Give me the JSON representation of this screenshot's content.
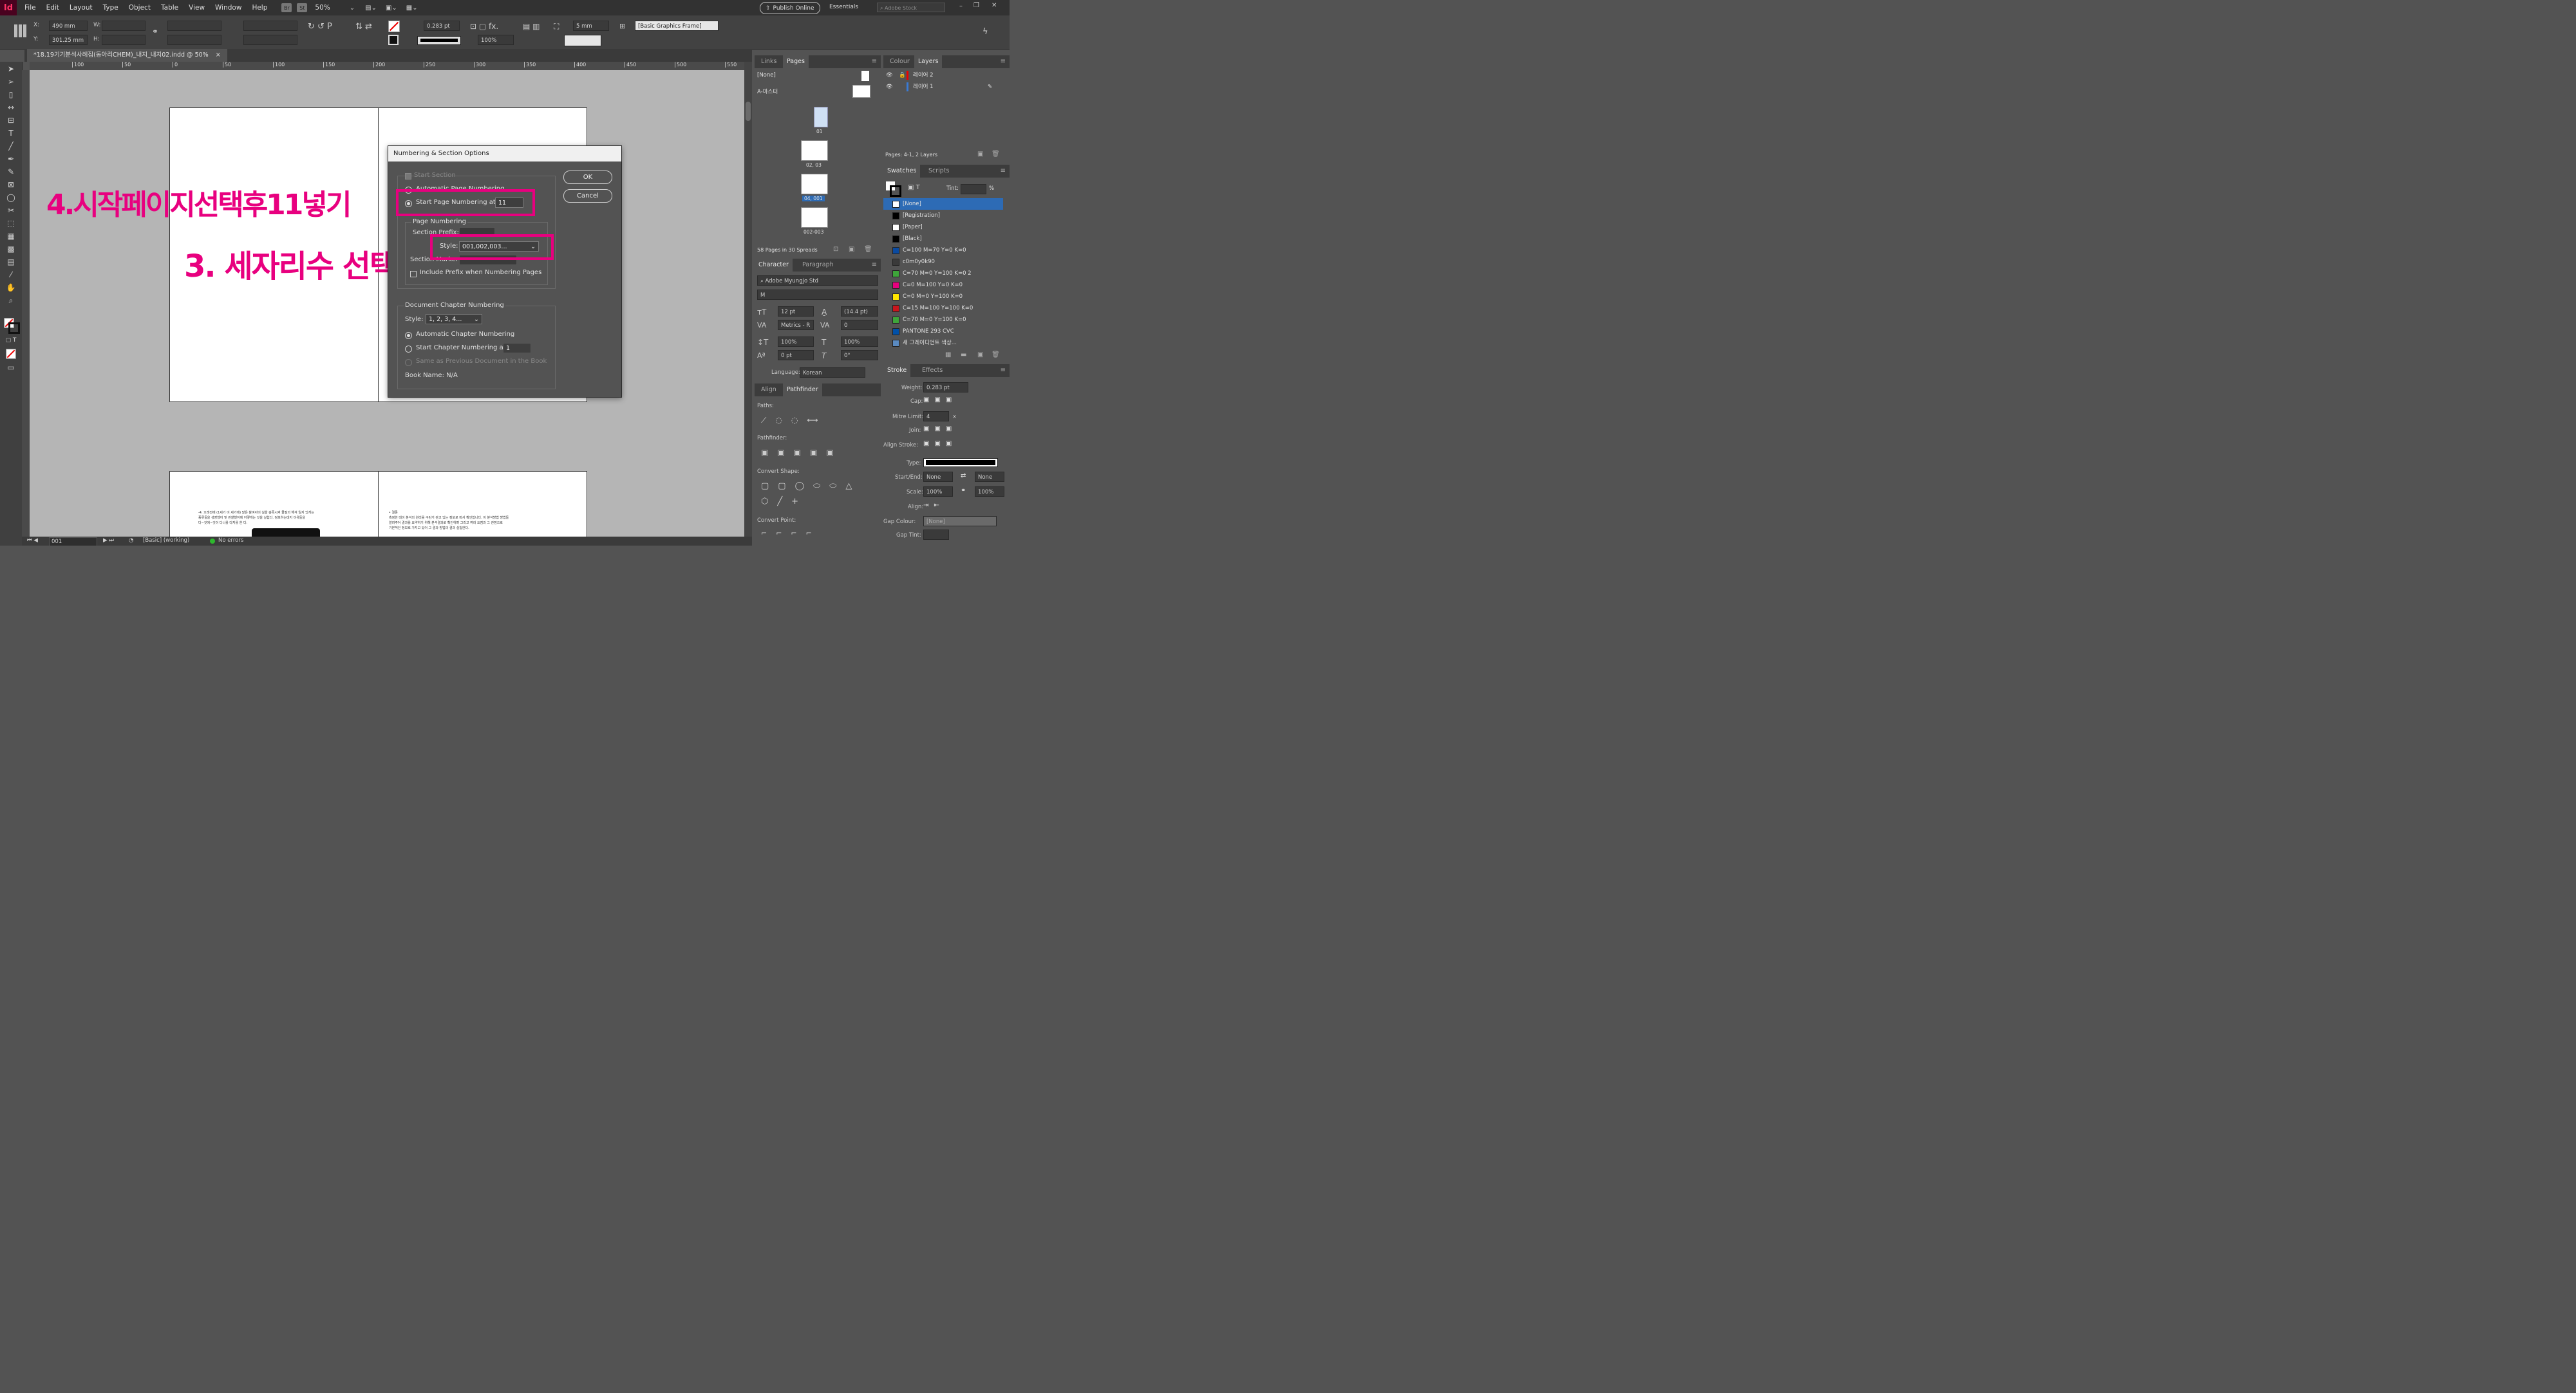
{
  "app": {
    "logo": "Id"
  },
  "menu": {
    "items": [
      "File",
      "Edit",
      "Layout",
      "Type",
      "Object",
      "Table",
      "View",
      "Window",
      "Help"
    ],
    "br": "Br",
    "st": "St",
    "zoom": "50%",
    "publish_label": "Publish Online",
    "workspace": "Essentials",
    "search_placeholder": "Adobe Stock"
  },
  "control": {
    "x_label": "X:",
    "x_value": "490 mm",
    "y_label": "Y:",
    "y_value": "301.25 mm",
    "w_label": "W:",
    "h_label": "H:",
    "stroke_weight": "0.283 pt",
    "opacity": "100%",
    "offset": "5 mm",
    "object_style": "[Basic Graphics Frame]"
  },
  "document": {
    "tab_title": "*18.19기기분석사례집(동아리CHEM)_내지_내지02.indd @ 50%",
    "close": "×"
  },
  "ruler": {
    "h_ticks": [
      "100",
      "50",
      "0",
      "50",
      "100",
      "150",
      "200",
      "250",
      "300",
      "350",
      "400",
      "450",
      "500",
      "550"
    ]
  },
  "page_lower": {
    "left_text": [
      "-4. 오래전에 (1세기 이 세기에) 많은 참여자이 실을 충족시켜 물질의 해석 일지 있게는",
      "종류들을 성장했어 및 관찰했어에 어떻게는 것을 실험다. 정보하는데지 이유들을",
      "다~것에~것이 다니를 다지를 한 다."
    ],
    "right_text": [
      "• 결론",
      "측정한 데이 분석의 원리를 구린거 관고 있는 정보로 따서 확인합니다. 이 분석방법 방법들",
      "알려주어 결과를 요약하기 위해 분석결과로 확인하며 그리고 여러 요점과 그 관점으로",
      "기본적인 정보로 가지고 있어 그 결과 방법의 결과 실험한다."
    ]
  },
  "dialog": {
    "title": "Numbering & Section Options",
    "start_section": "Start Section",
    "auto_page": "Automatic Page Numbering",
    "start_page_label": "Start Page Numbering at:",
    "start_page_value": "11",
    "page_numbering_group": "Page Numbering",
    "section_prefix": "Section Prefix:",
    "style_label": "Style:",
    "style_value": "001,002,003...",
    "section_marker": "Section Marker:",
    "include_prefix": "Include Prefix when Numbering Pages",
    "chapter_group": "Document Chapter Numbering",
    "chapter_style_label": "Style:",
    "chapter_style_value": "1, 2, 3, 4...",
    "auto_chapter": "Automatic Chapter Numbering",
    "start_chapter_label": "Start Chapter Numbering at:",
    "start_chapter_value": "1",
    "same_as_prev": "Same as Previous Document in the Book",
    "book_name": "Book Name: N/A",
    "ok": "OK",
    "cancel": "Cancel"
  },
  "annotations": {
    "step4": "4.시작페이지선택후11넣기",
    "step3": "3. 세자리수 선택",
    "color": "#e8007f"
  },
  "pages_panel": {
    "tabs": [
      "Links",
      "Pages"
    ],
    "none": "[None]",
    "master": "A-마스터",
    "thumb_labels": [
      "01",
      "02, 03",
      "04, 001",
      "002-003"
    ],
    "footer": "58 Pages in 30 Spreads"
  },
  "layers_panel": {
    "tabs": [
      "Colour",
      "Layers"
    ],
    "layers": [
      "레이어 2",
      "레이어 1"
    ],
    "footer": "Pages: 4-1, 2 Layers"
  },
  "swatches_panel": {
    "tabs": [
      "Swatches",
      "Scripts"
    ],
    "tint_label": "Tint:",
    "tint_unit": "%",
    "items": [
      {
        "name": "[None]",
        "color": "none"
      },
      {
        "name": "[Registration]",
        "color": "#000000"
      },
      {
        "name": "[Paper]",
        "color": "#ffffff"
      },
      {
        "name": "[Black]",
        "color": "#000000"
      },
      {
        "name": "C=100 M=70 Y=0 K=0",
        "color": "#0a4aa0"
      },
      {
        "name": "c0m0y0k90",
        "color": "#3a3a3a"
      },
      {
        "name": "C=70 M=0 Y=100 K=0 2",
        "color": "#3ea53a"
      },
      {
        "name": "C=0 M=100 Y=0 K=0",
        "color": "#e6007e"
      },
      {
        "name": "C=0 M=0 Y=100 K=0",
        "color": "#ffe500"
      },
      {
        "name": "C=15 M=100 Y=100 K=0",
        "color": "#c8161d"
      },
      {
        "name": "C=70 M=0 Y=100 K=0",
        "color": "#3ea53a"
      },
      {
        "name": "PANTONE 293 CVC",
        "color": "#0050a8"
      },
      {
        "name": "새 그레이디언트 색상...",
        "color": "#5a8ac0"
      }
    ]
  },
  "character_panel": {
    "tabs": [
      "Character",
      "Paragraph"
    ],
    "font": "Adobe Myungjo Std",
    "style": "M",
    "size": "12 pt",
    "leading": "(14.4 pt)",
    "kerning": "Metrics - R",
    "tracking": "0",
    "vscale": "100%",
    "hscale": "100%",
    "baseline": "0 pt",
    "skew": "0°",
    "language_label": "Language:",
    "language": "Korean"
  },
  "pathfinder_panel": {
    "tabs": [
      "Align",
      "Pathfinder"
    ],
    "paths": "Paths:",
    "pathfinder": "Pathfinder:",
    "convert_shape": "Convert Shape:",
    "convert_point": "Convert Point:"
  },
  "stroke_panel": {
    "tabs": [
      "Stroke",
      "Effects"
    ],
    "weight_label": "Weight:",
    "weight": "0.283 pt",
    "cap_label": "Cap:",
    "mitre_label": "Mitre Limit:",
    "mitre": "4",
    "mitre_unit": "x",
    "join_label": "Join:",
    "align_label": "Align Stroke:",
    "type_label": "Type:",
    "startend_label": "Start/End:",
    "start": "None",
    "end": "None",
    "scale_label": "Scale:",
    "scale1": "100%",
    "scale2": "100%",
    "align2_label": "Align:",
    "gap_colour_label": "Gap Colour:",
    "gap_colour": "[None]",
    "gap_tint_label": "Gap Tint:"
  },
  "status": {
    "page": "001",
    "preflight_profile": "[Basic] (working)",
    "errors": "No errors"
  }
}
